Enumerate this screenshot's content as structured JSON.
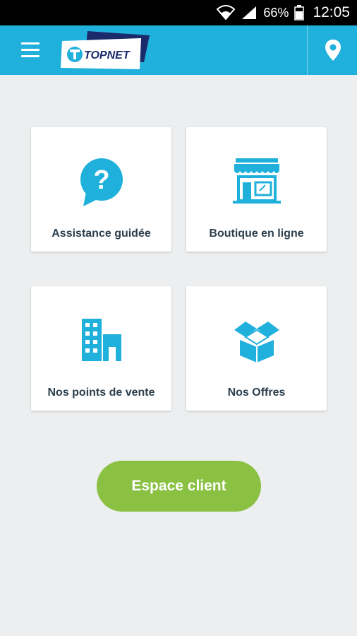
{
  "status_bar": {
    "battery": "66%",
    "time": "12:05"
  },
  "app_bar": {
    "logo_text": "TOPNET",
    "brand_color": "#1fb0dc",
    "menu_icon": "hamburger-menu-icon",
    "location_icon": "location-pin-icon"
  },
  "cards": [
    {
      "label": "Assistance guidée",
      "icon": "question-bubble-icon"
    },
    {
      "label": "Boutique en ligne",
      "icon": "storefront-icon"
    },
    {
      "label": "Nos points de vente",
      "icon": "buildings-icon"
    },
    {
      "label": "Nos Offres",
      "icon": "open-box-icon"
    }
  ],
  "cta": {
    "label": "Espace client",
    "color": "#8ac142"
  },
  "colors": {
    "accent": "#1fb0dc",
    "background": "#eceeef",
    "card_text": "#2c3e4c"
  }
}
